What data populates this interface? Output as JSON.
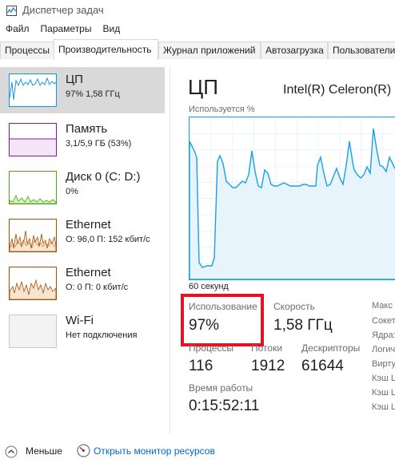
{
  "window": {
    "title": "Диспетчер задач"
  },
  "menu": [
    "Файл",
    "Параметры",
    "Вид"
  ],
  "tabs": [
    "Процессы",
    "Производительность",
    "Журнал приложений",
    "Автозагрузка",
    "Пользователи"
  ],
  "active_tab": "Производительность",
  "resources": [
    {
      "name": "ЦП",
      "detail": "97%  1,58 ГГц",
      "color": "#1796e0",
      "selected": true
    },
    {
      "name": "Память",
      "detail": "3,1/5,9 ГБ (53%)",
      "color": "#8b12ae",
      "selected": false
    },
    {
      "name": "Диск 0 (C: D:)",
      "detail": "0%",
      "color": "#4da60c",
      "selected": false
    },
    {
      "name": "Ethernet",
      "detail": "О: 96,0  П: 152 кбит/с",
      "color": "#a74f01",
      "selected": false
    },
    {
      "name": "Ethernet",
      "detail": "О: 0  П: 0 кбит/с",
      "color": "#a74f01",
      "selected": false
    },
    {
      "name": "Wi-Fi",
      "detail": "Нет подключения",
      "color": "#a0a0a0",
      "selected": false
    }
  ],
  "cpu": {
    "title": "ЦП",
    "model": "Intel(R) Celeron(R)",
    "graph_top_label": "Используется %",
    "graph_bottom_label": "60 секунд",
    "graph_color": "#17a1e6",
    "usage_label": "Использование",
    "usage_value": "97%",
    "speed_label": "Скорость",
    "speed_value": "1,58 ГГц",
    "processes_label": "Процессы",
    "processes_value": "116",
    "threads_label": "Потоки",
    "threads_value": "1912",
    "handles_label": "Дескрипторы",
    "handles_value": "61644",
    "uptime_label": "Время работы",
    "uptime_value": "0:15:52:11",
    "side_labels": [
      "Макс",
      "Сокет",
      "Ядра:",
      "Логич",
      "Вирту",
      "Кэш L",
      "Кэш L",
      "Кэш L"
    ]
  },
  "footer": {
    "less_label": "Меньше",
    "monitor_link": "Открыть монитор ресурсов"
  }
}
